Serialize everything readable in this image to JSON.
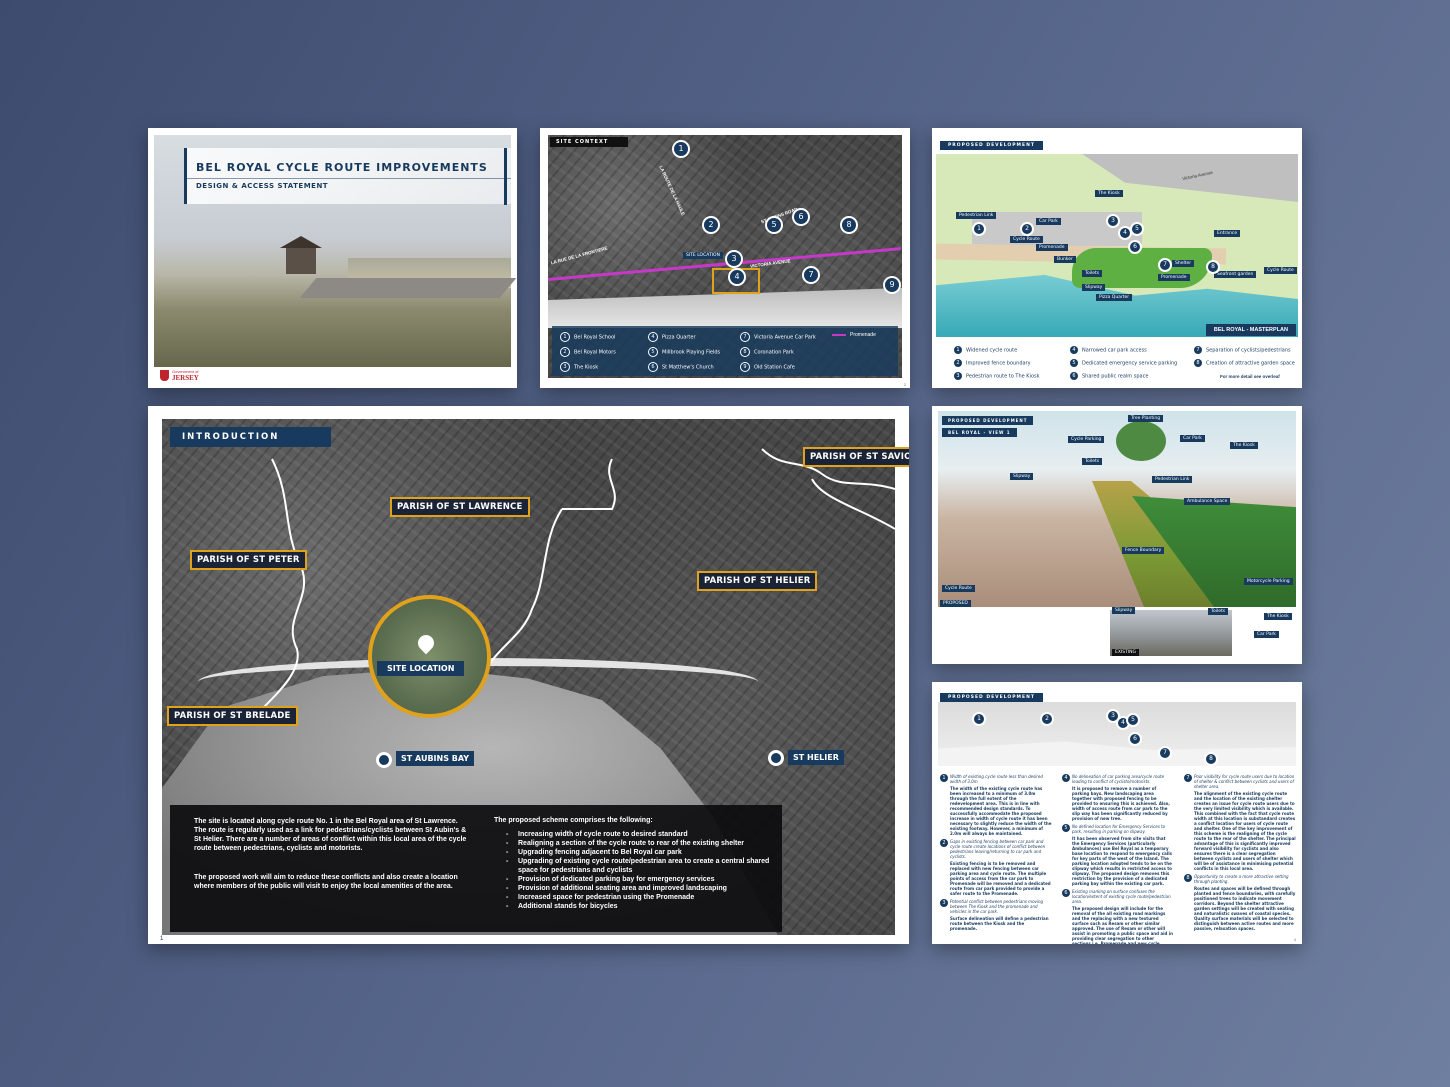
{
  "cover": {
    "title": "BEL ROYAL CYCLE ROUTE IMPROVEMENTS",
    "subtitle": "DESIGN & ACCESS STATEMENT",
    "logo_small": "Government of",
    "logo_big": "JERSEY"
  },
  "site_context": {
    "tag": "SITE CONTEXT",
    "site_label": "SITE LOCATION",
    "roads": [
      "LA RUE DE LA FRONTIERE",
      "LA ROUTE DE LA HAULE",
      "VICTORIA AVENUE",
      "ST AUBINS ROAD"
    ],
    "legend": [
      {
        "n": "1",
        "label": "Bel Royal School"
      },
      {
        "n": "2",
        "label": "Bel Royal Motors"
      },
      {
        "n": "3",
        "label": "The Kiosk"
      },
      {
        "n": "4",
        "label": "Pizza Quarter"
      },
      {
        "n": "5",
        "label": "Millbrook Playing Fields"
      },
      {
        "n": "6",
        "label": "St Matthew's Church"
      },
      {
        "n": "7",
        "label": "Victoria Avenue Car Park"
      },
      {
        "n": "8",
        "label": "Coronation Park"
      },
      {
        "n": "9",
        "label": "Old Station Cafe"
      }
    ],
    "promenade": "Promenade",
    "page": "2"
  },
  "masterplan": {
    "tag": "PROPOSED DEVELOPMENT",
    "badge": "BEL ROYAL - MASTERPLAN",
    "labels": [
      "Pedestrian Link",
      "Car Park",
      "Cycle Route",
      "Promenade",
      "The Kiosk",
      "Shelter",
      "Bunker",
      "Toilets",
      "Slipway",
      "Pizza Quarter",
      "Promenade",
      "Seafront garden",
      "Cycle Route",
      "Entrance",
      "Victoria Avenue"
    ],
    "legend": [
      {
        "n": "1",
        "label": "Widened cycle route"
      },
      {
        "n": "2",
        "label": "Improved fence boundary"
      },
      {
        "n": "3",
        "label": "Pedestrian route to The Kiosk"
      },
      {
        "n": "4",
        "label": "Narrowed car park access"
      },
      {
        "n": "5",
        "label": "Dedicated emergency service parking"
      },
      {
        "n": "6",
        "label": "Shared public realm space"
      },
      {
        "n": "7",
        "label": "Separation of cyclists/pedestrians"
      },
      {
        "n": "8",
        "label": "Creation of attractive garden space"
      }
    ],
    "more": "For more detail see overleaf"
  },
  "intro": {
    "tag": "INTRODUCTION",
    "parishes": [
      "PARISH OF ST SAVIOR",
      "PARISH OF ST LAWRENCE",
      "PARISH OF ST PETER",
      "PARISH OF ST HELIER",
      "PARISH OF ST BRELADE"
    ],
    "site_location": "SITE LOCATION",
    "st_aubins_bay": "ST AUBINS BAY",
    "st_helier": "ST HELIER",
    "para1": "The site is located along cycle route No. 1 in the Bel Royal area of St Lawrence. The route is regularly used as a link for pedestrians/cyclists between St Aubin's & St Helier. There are a number of areas of conflict within this local area of the cycle route between pedestrians, cyclists and motorists.",
    "para2": "The proposed work will aim to reduce these conflicts and also create a location where members of the public will visit to enjoy the local amenities of the area.",
    "scheme_heading": "The proposed scheme comprises the following:",
    "scheme": [
      "Increasing width of cycle route to desired standard",
      "Realigning a section of the cycle route to rear of the existing shelter",
      "Upgrading fencing adjacent to Bel Royal car park",
      "Upgrading of existing cycle route/pedestrian area to create a central shared space for pedestrians and cyclists",
      "Provision of dedicated parking bay for emergency services",
      "Provision of additional seating area and improved landscaping",
      "Increased space for pedestrian using the Promenade",
      "Additional stands for bicycles"
    ],
    "page": "1"
  },
  "view1": {
    "tag": "PROPOSED DEVELOPMENT",
    "subtag": "BEL ROYAL - VIEW 1",
    "labels": [
      "Tree Planting",
      "Cycle Parking",
      "Car Park",
      "The Kiosk",
      "Toilets",
      "Slipway",
      "Pedestrian Link",
      "Ambulance Space",
      "Fence Boundary",
      "Cycle Route",
      "Motorcycle Parking"
    ],
    "proposed": "PROPOSED",
    "existing": "EXISTING",
    "photo_labels": [
      "Slipway",
      "Toilets",
      "The Kiosk",
      "Car Park"
    ]
  },
  "detail": {
    "tag": "PROPOSED DEVELOPMENT",
    "columns": [
      [
        {
          "n": "1",
          "head": "Width of existing cycle route less than desired width of 3.0m",
          "body": "The width of the existing cycle route has been increased to a minimum of 3.0m through the full extent of the redevelopment area. This is in line with recommended design standards. To successfully accommodate the proposed increase in width of cycle route it has been necessary to slightly reduce the width of the existing footway. However, a minimum of 2.0m will always be maintained."
        },
        {
          "n": "2",
          "head": "Gaps in existing fencing between car park and cycle route create locations of conflict between pedestrians leaving/returning to car park and cyclists.",
          "body": "Existing fencing is to be removed and replaced with new fencing between car parking area and cycle route. The multiple points of access from the car park to Promenade will be removed and a dedicated route from car park provided to provide a safer route to the Promenade."
        },
        {
          "n": "3",
          "head": "Potential conflict between pedestrians moving between The Kiosk and the promenade and vehicles in the car park.",
          "body": "Surface delineation will define a pedestrian route between the Kiosk and the promenade."
        }
      ],
      [
        {
          "n": "4",
          "head": "No delineation of car parking area/cycle route leading to conflict of cyclists/motorists.",
          "body": "It is proposed to remove a number of parking bays. New landscaping area together with proposed fencing to be provided to ensuring this is achieved. Also, width of access route from car park to the slip way has been significantly reduced by provision of new tree."
        },
        {
          "n": "5",
          "head": "No defined location for Emergency Services to park, resulting in parking on slipway.",
          "body": "It has been observed from site visits that the Emergency Services (particularly Ambulances) use Bel Royal as a temporary base location to respond to emergency calls for key parts of the west of the Island. The parking location adopted tends to be on the slipway which results in restricted access to slipway. The proposed design removes this restriction by the provision of a dedicated parking bay within the existing car park."
        },
        {
          "n": "6",
          "head": "Existing marking on surface confuses the location/extent of existing cycle route/pedestrian area.",
          "body": "The proposed design will include for the removal of the all existing road markings and the replacing with a new textured surface such as Resam or other similar approved. The use of Resam or other will assist in promoting a public space and aid in providing clear segregation to other sections i.e. Promenade and new cycle route."
        }
      ],
      [
        {
          "n": "7",
          "head": "Poor visibility for cycle route users due to location of shelter & conflict between cyclists and users of shelter area.",
          "body": "The alignment of the existing cycle route and the location of the existing shelter creates an issue for cycle route users due to the very limited visibility which is available. This combined with the fact that cycle route width at this location is substandard creates a conflict location for users of cycle route and shelter. One of the key improvement of this scheme is the realigning of the cycle route to the rear of the shelter. The principal advantage of this is significantly improved forward visibility for cyclists and also ensures there is a clear segregation between cyclists and users of shelter which will be of assistance in minimising potential conflicts in this local area."
        },
        {
          "n": "8",
          "head": "Opportunity to create a more attractive setting through planting.",
          "body": "Routes and spaces will be defined through planted and fence boundaries, with carefully positioned trees to indicate movement corridors. Beyond the shelter attractive garden settings will be created with seating and naturalistic swaves of coastal species. Quality surface materials will be selected to distinguish between active routes and more passive, relaxation spaces."
        }
      ]
    ],
    "page": "4"
  }
}
